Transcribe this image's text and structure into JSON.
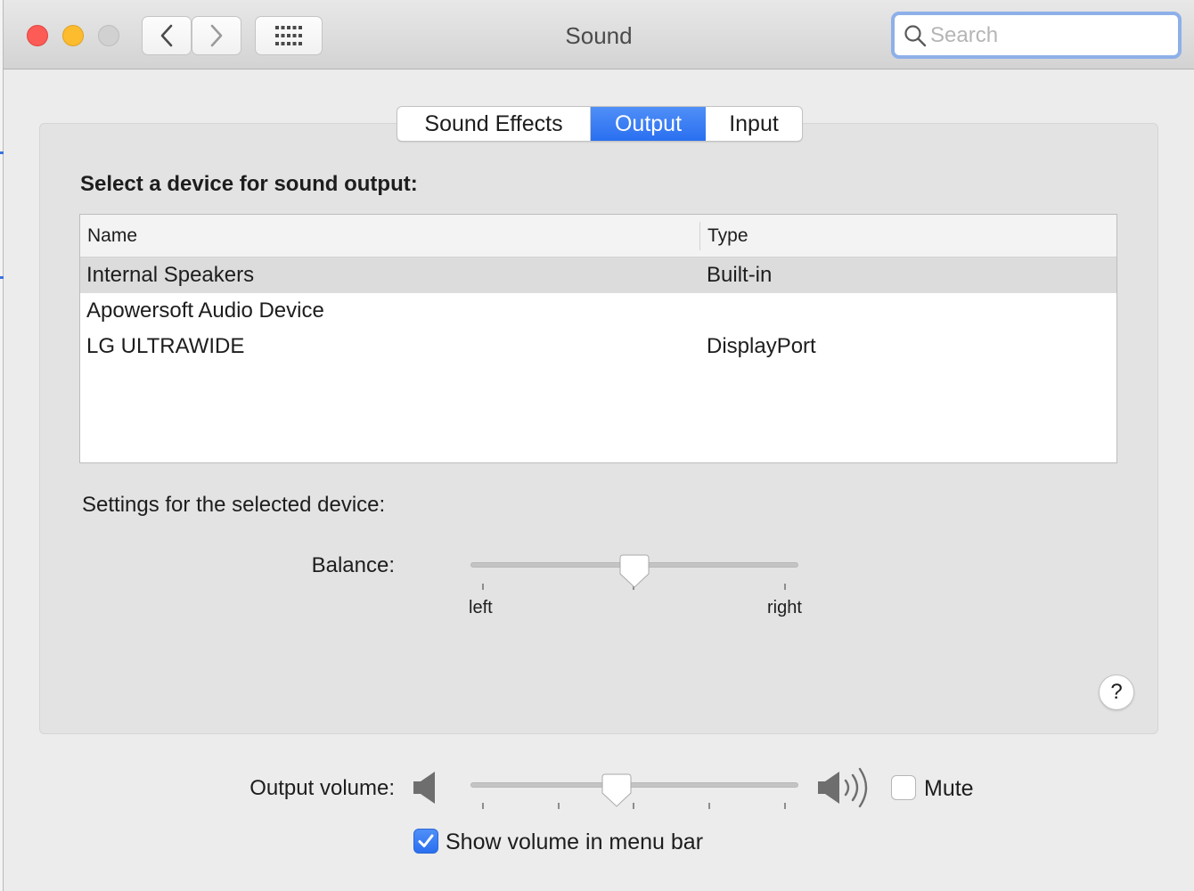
{
  "window": {
    "title": "Sound"
  },
  "search": {
    "placeholder": "Search"
  },
  "tabs": [
    {
      "label": "Sound Effects",
      "selected": false
    },
    {
      "label": "Output",
      "selected": true
    },
    {
      "label": "Input",
      "selected": false
    }
  ],
  "output": {
    "heading": "Select a device for sound output:",
    "columns": {
      "name": "Name",
      "type": "Type"
    },
    "devices": [
      {
        "name": "Internal Speakers",
        "type": "Built-in",
        "selected": true
      },
      {
        "name": "Apowersoft Audio Device",
        "type": "",
        "selected": false
      },
      {
        "name": "LG ULTRAWIDE",
        "type": "DisplayPort",
        "selected": false
      }
    ],
    "settings_label": "Settings for the selected device:",
    "balance": {
      "label": "Balance:",
      "left_label": "left",
      "right_label": "right",
      "value": 0.5
    },
    "help_label": "?"
  },
  "volume": {
    "label": "Output volume:",
    "value": 0.44,
    "mute_label": "Mute",
    "mute_checked": false,
    "show_in_menu_bar_label": "Show volume in menu bar",
    "show_in_menu_bar_checked": true
  },
  "colors": {
    "accent": "#2a6ff0",
    "close": "#fd5b56",
    "minimize": "#fdbc2e"
  },
  "icons": [
    "close-button",
    "minimize-button",
    "zoom-button",
    "chevron-left-icon",
    "chevron-right-icon",
    "grid-icon",
    "search-icon",
    "speaker-low-icon",
    "speaker-high-icon",
    "checkmark-icon"
  ]
}
